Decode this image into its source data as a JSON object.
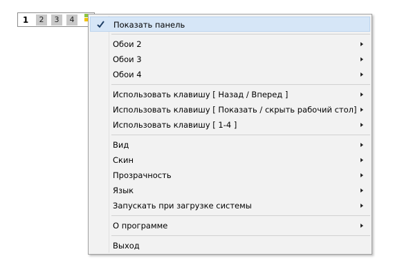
{
  "desktop_switcher": {
    "buttons": [
      "1",
      "2",
      "3",
      "4"
    ],
    "active_index": 0,
    "grid_icon": "panel-grid-icon"
  },
  "menu": {
    "items": [
      {
        "label": "Показать панель",
        "checked": true,
        "submenu": false
      },
      {
        "label": "Обои 2",
        "submenu": true
      },
      {
        "label": "Обои 3",
        "submenu": true
      },
      {
        "label": "Обои 4",
        "submenu": true
      },
      {
        "label": "Использовать клавишу [ Назад / Вперед ]",
        "submenu": true
      },
      {
        "label": "Использовать клавишу [ Показать / скрыть рабочий стол]",
        "submenu": true
      },
      {
        "label": "Использовать клавишу [ 1-4 ]",
        "submenu": true
      },
      {
        "label": "Вид",
        "submenu": true
      },
      {
        "label": "Скин",
        "submenu": true
      },
      {
        "label": "Прозрачность",
        "submenu": true
      },
      {
        "label": "Язык",
        "submenu": true
      },
      {
        "label": "Запускать при загрузке системы",
        "submenu": true
      },
      {
        "label": "О программе",
        "submenu": true
      },
      {
        "label": "Выход",
        "submenu": false
      }
    ]
  },
  "colors": {
    "grid_green": "#8cc63f",
    "grid_yellow": "#f2c200",
    "grid_grey": "#b0b0b0"
  }
}
